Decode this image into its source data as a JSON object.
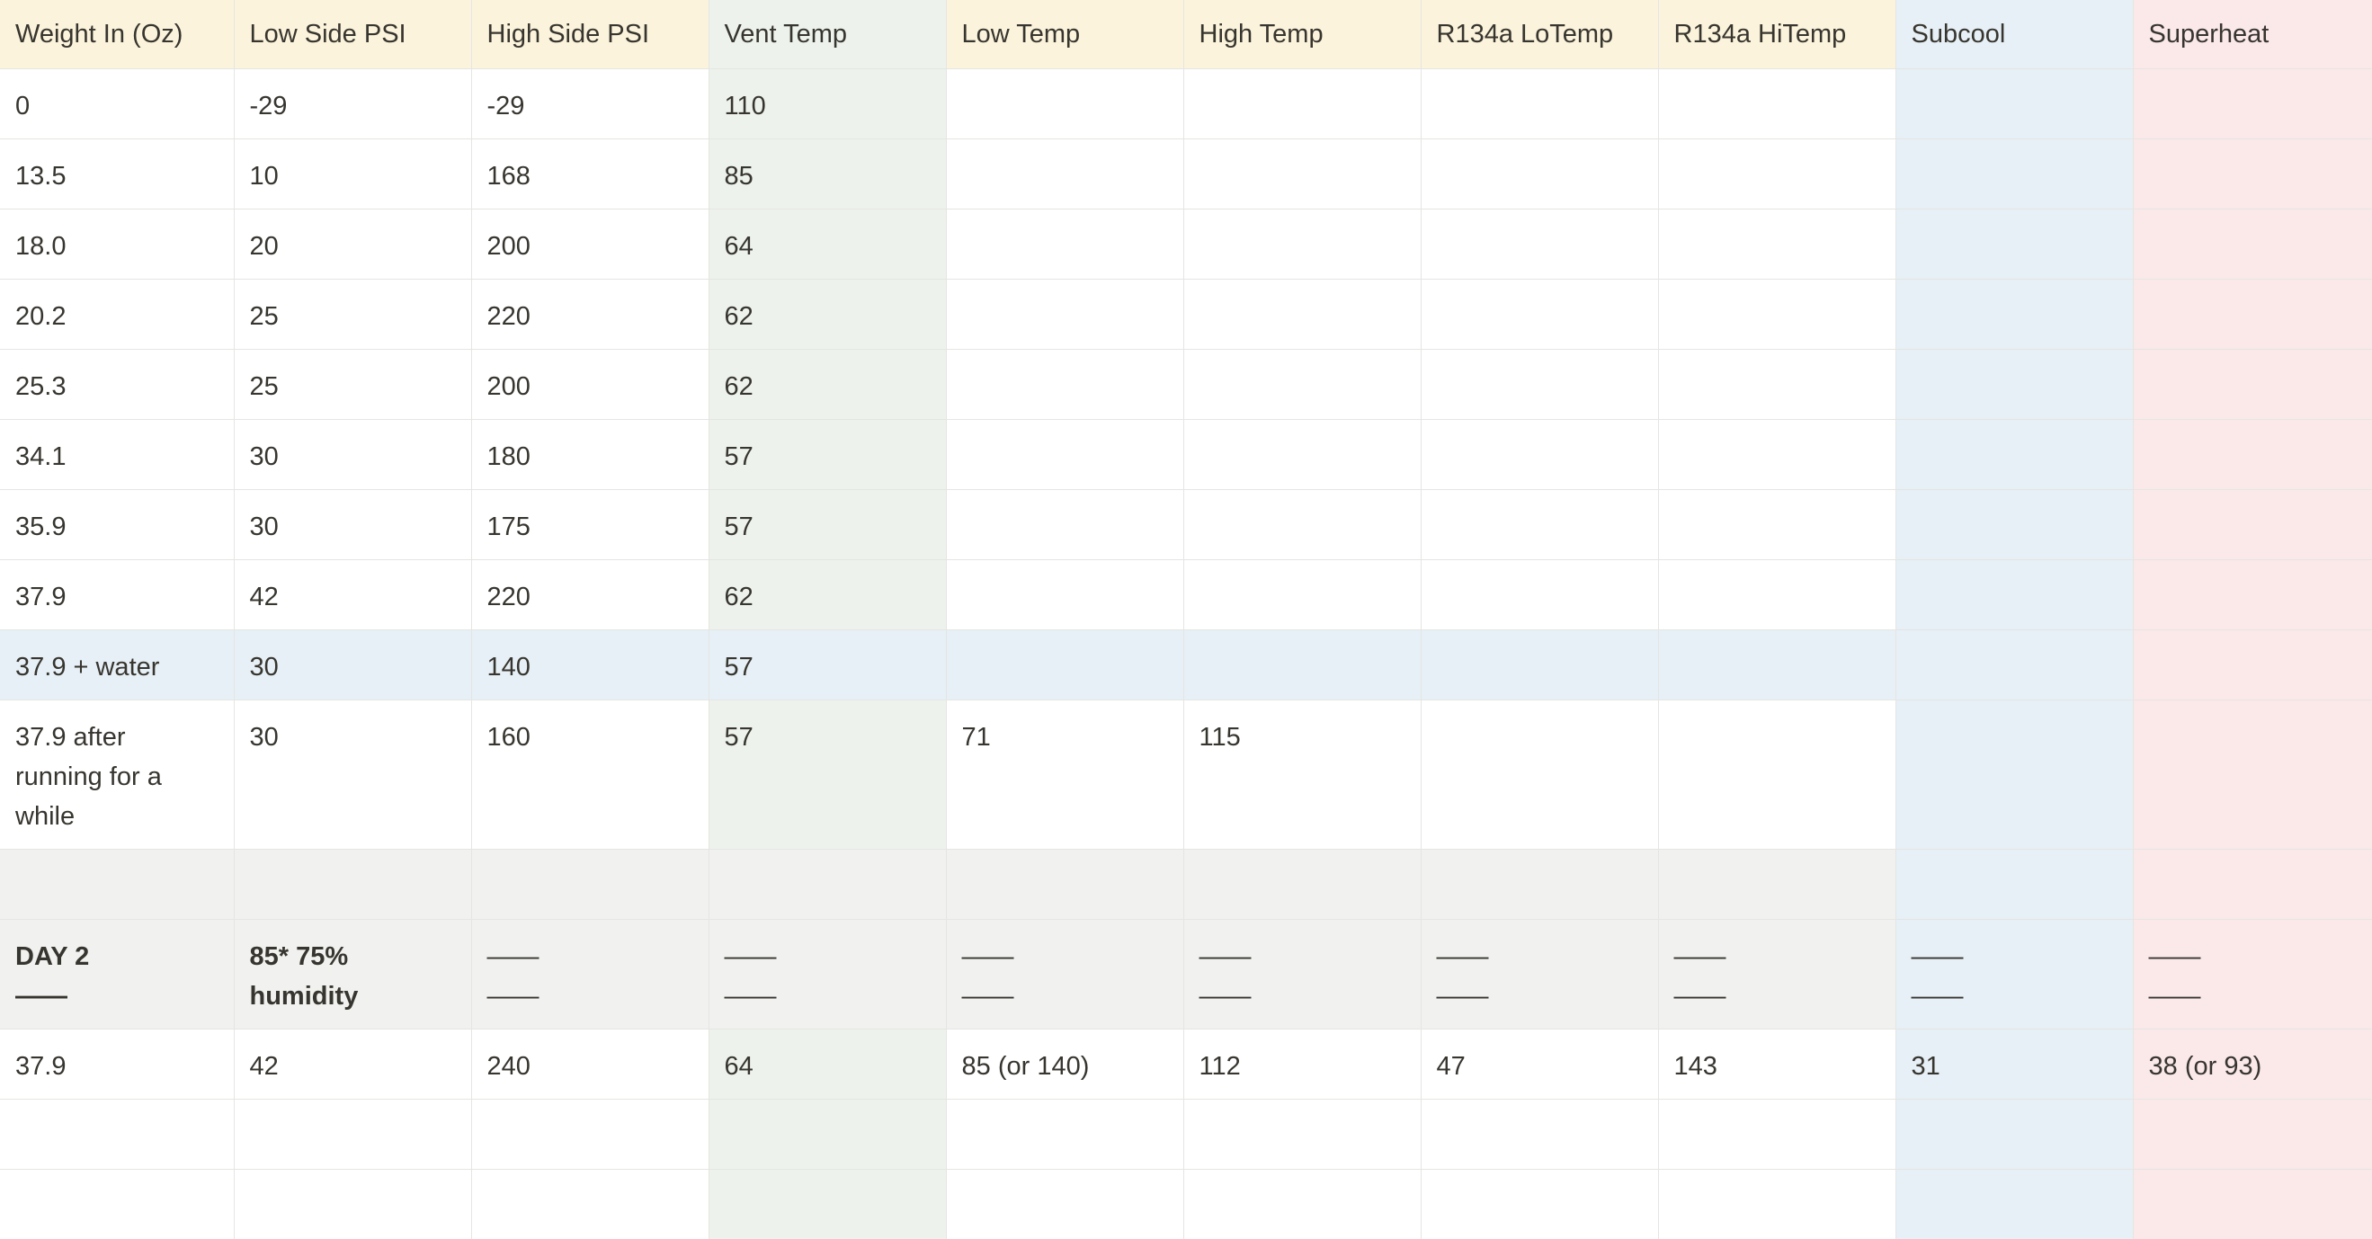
{
  "headers": [
    "Weight In (Oz)",
    "Low Side PSI",
    "High Side PSI",
    "Vent Temp",
    "Low Temp",
    "High Temp",
    "R134a LoTemp",
    "R134a HiTemp",
    "Subcool",
    "Superheat"
  ],
  "rows": [
    [
      "0",
      "-29",
      "-29",
      "110",
      "",
      "",
      "",
      "",
      "",
      ""
    ],
    [
      "13.5",
      "10",
      "168",
      "85",
      "",
      "",
      "",
      "",
      "",
      ""
    ],
    [
      "18.0",
      "20",
      "200",
      "64",
      "",
      "",
      "",
      "",
      "",
      ""
    ],
    [
      "20.2",
      "25",
      "220",
      "62",
      "",
      "",
      "",
      "",
      "",
      ""
    ],
    [
      "25.3",
      "25",
      "200",
      "62",
      "",
      "",
      "",
      "",
      "",
      ""
    ],
    [
      "34.1",
      "30",
      "180",
      "57",
      "",
      "",
      "",
      "",
      "",
      ""
    ],
    [
      "35.9",
      "30",
      "175",
      "57",
      "",
      "",
      "",
      "",
      "",
      ""
    ],
    [
      "37.9",
      "42",
      "220",
      "62",
      "",
      "",
      "",
      "",
      "",
      ""
    ],
    [
      "37.9 + water",
      "30",
      "140",
      "57",
      "",
      "",
      "",
      "",
      "",
      ""
    ],
    [
      "37.9 after running for a while",
      "30",
      "160",
      "57",
      "71",
      "115",
      "",
      "",
      "",
      ""
    ],
    [
      "",
      "",
      "",
      "",
      "",
      "",
      "",
      "",
      "",
      ""
    ],
    [
      "DAY 2\n——",
      "85* 75% humidity",
      "——\n——",
      "——\n——",
      "——\n——",
      "——\n——",
      "——\n——",
      "——\n——",
      "——\n——",
      "——\n——"
    ],
    [
      "37.9",
      "42",
      "240",
      "64",
      "85 (or 140)",
      "112",
      "47",
      "143",
      "31",
      "38 (or 93)"
    ],
    [
      "",
      "",
      "",
      "",
      "",
      "",
      "",
      "",
      "",
      ""
    ],
    [
      "",
      "",
      "",
      "",
      "",
      "",
      "",
      "",
      "",
      ""
    ]
  ],
  "colors": {
    "header_bg": "#fbf3db",
    "vent_temp_bg": "#edf3ec",
    "subcool_bg": "#e7f0f6",
    "superheat_bg": "#fbe9e9",
    "highlight_row_bg": "#e7f0f6",
    "gray_row_bg": "#f1f1ef"
  }
}
